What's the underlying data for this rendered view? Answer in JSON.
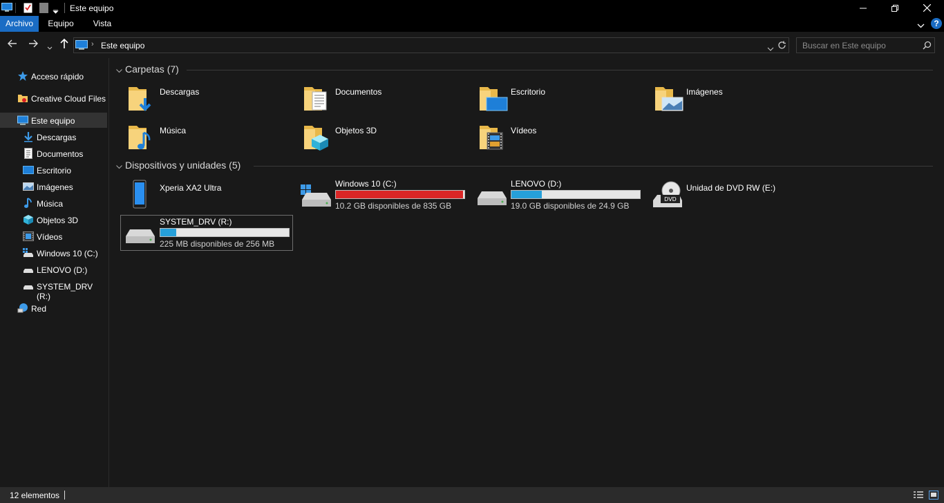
{
  "window": {
    "title": "Este equipo"
  },
  "ribbon": {
    "tabs": [
      {
        "label": "Archivo"
      },
      {
        "label": "Equipo"
      },
      {
        "label": "Vista"
      }
    ]
  },
  "address": {
    "path": "Este equipo",
    "search_placeholder": "Buscar en Este equipo"
  },
  "nav": {
    "items": [
      {
        "label": "Acceso rápido",
        "icon": "star-icon"
      },
      {
        "label": "Creative Cloud Files",
        "icon": "creative-cloud-icon"
      },
      {
        "label": "Este equipo",
        "icon": "computer-icon",
        "selected": true
      },
      {
        "label": "Descargas",
        "icon": "download-icon"
      },
      {
        "label": "Documentos",
        "icon": "document-icon"
      },
      {
        "label": "Escritorio",
        "icon": "desktop-icon"
      },
      {
        "label": "Imágenes",
        "icon": "pictures-icon"
      },
      {
        "label": "Música",
        "icon": "music-icon"
      },
      {
        "label": "Objetos 3D",
        "icon": "cube-icon"
      },
      {
        "label": "Vídeos",
        "icon": "video-icon"
      },
      {
        "label": "Windows 10 (C:)",
        "icon": "drive-icon"
      },
      {
        "label": "LENOVO (D:)",
        "icon": "drive-icon"
      },
      {
        "label": "SYSTEM_DRV (R:)",
        "icon": "drive-icon"
      },
      {
        "label": "Red",
        "icon": "network-icon"
      }
    ]
  },
  "folders": {
    "header": "Carpetas (7)",
    "items": [
      {
        "label": "Descargas",
        "icon": "download-folder-icon"
      },
      {
        "label": "Documentos",
        "icon": "documents-folder-icon"
      },
      {
        "label": "Escritorio",
        "icon": "desktop-folder-icon"
      },
      {
        "label": "Imágenes",
        "icon": "pictures-folder-icon"
      },
      {
        "label": "Música",
        "icon": "music-folder-icon"
      },
      {
        "label": "Objetos 3D",
        "icon": "3d-objects-folder-icon"
      },
      {
        "label": "Vídeos",
        "icon": "videos-folder-icon"
      }
    ]
  },
  "devices": {
    "header": "Dispositivos y unidades (5)",
    "items": [
      {
        "label": "Xperia XA2 Ultra",
        "icon": "phone-icon"
      },
      {
        "label": "Windows 10 (C:)",
        "icon": "windows-drive-icon",
        "free_text": "10.2 GB disponibles de 835 GB",
        "used_fraction": 0.988,
        "bar_color": "#da2626"
      },
      {
        "label": "LENOVO (D:)",
        "icon": "drive-icon",
        "free_text": "19.0 GB disponibles de 24.9 GB",
        "used_fraction": 0.237,
        "bar_color": "#26a0da"
      },
      {
        "label": "Unidad de DVD RW (E:)",
        "icon": "dvd-drive-icon"
      },
      {
        "label": "SYSTEM_DRV (R:)",
        "icon": "drive-icon",
        "free_text": "225 MB disponibles de 256 MB",
        "used_fraction": 0.121,
        "bar_color": "#26a0da"
      }
    ]
  },
  "status": {
    "count": "12 elementos"
  },
  "colors": {
    "accent": "#1a6cc4",
    "progress_normal": "#26a0da",
    "progress_full": "#da2626",
    "folder": "#f3c45c"
  }
}
